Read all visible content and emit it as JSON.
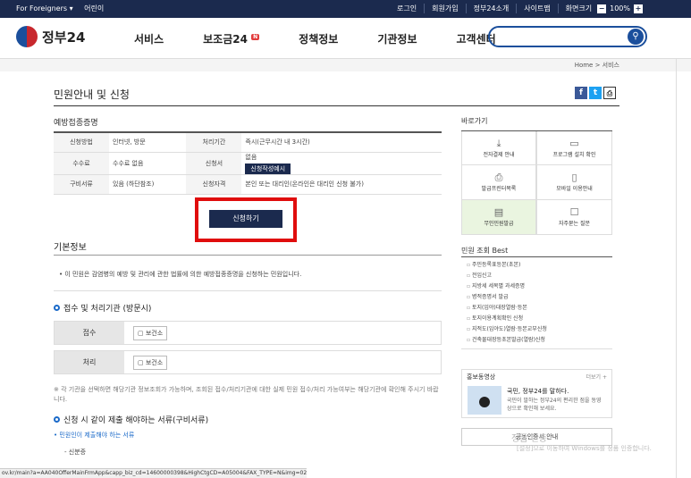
{
  "topbar": {
    "foreigners": "For Foreigners ▾",
    "kids": "어린이",
    "links": [
      "로그인",
      "회원가입",
      "정부24소개",
      "사이트맵",
      "화면크기"
    ],
    "zoom_minus": "−",
    "zoom_value": "100%",
    "zoom_plus": "+"
  },
  "gnb": {
    "logo": "정부24",
    "menu": [
      "서비스",
      "보조금24",
      "정책정보",
      "기관정보",
      "고객센터"
    ],
    "badge": "N",
    "search_icon": "search-icon"
  },
  "breadcrumb": "Home > 서비스",
  "page_title": "민원안내 및 신청",
  "service_name": "예방접종증명",
  "info_rows": [
    {
      "k1": "신청방법",
      "v1": "인터넷, 방문",
      "k2": "처리기간",
      "v2": "즉시(근무시간 내 3시간)"
    },
    {
      "k1": "수수료",
      "v1": "수수료 없음",
      "k2": "신청서",
      "v2": "없음",
      "btn": "신청작성예시"
    },
    {
      "k1": "구비서류",
      "v1": "있음 (하단참조)",
      "k2": "신청자격",
      "v2": "본인 또는 대리인(온라인은 대리인 신청 불가)"
    }
  ],
  "apply_button": "신청하기",
  "basic_info": {
    "title": "기본정보",
    "notice": "• 이 민원은 감염병의 예방 및 관리에 관한 법률에 의한 예방접종증명을 신청하는 민원입니다."
  },
  "processing": {
    "title": "접수 및 처리기관 (방문시)",
    "rows": [
      {
        "label": "접수",
        "tag": "보건소"
      },
      {
        "label": "처리",
        "tag": "보건소"
      }
    ],
    "note": "※ 각 기관을 선택하면 해당기관 정보조회가 가능하며, 조회된 접수/처리기관에 대한 실제 민원 접수/처리 가능여부는 해당기관에 확인해 주시기 바랍니다."
  },
  "documents": {
    "title": "신청 시 같이 제출 해야하는 서류(구비서류)",
    "link": "• 민원인이 제출해야 하는 서류",
    "item": "- 신분증"
  },
  "sidebar": {
    "quick_title": "바로가기",
    "quick": [
      {
        "label": "전자결제 안내",
        "icon": "download-icon"
      },
      {
        "label": "프로그램 설치 확인",
        "icon": "monitor-icon"
      },
      {
        "label": "발급프린터목록",
        "icon": "printer-icon"
      },
      {
        "label": "모바일 이용안내",
        "icon": "mobile-icon"
      },
      {
        "label": "무인민원발급",
        "icon": "kiosk-icon"
      },
      {
        "label": "자주묻는 질문",
        "icon": "faq-icon"
      }
    ],
    "best_title": "민원 조회 Best",
    "best": [
      "주민등록표등본(초본)",
      "전입신고",
      "지방세 세목별 과세증명",
      "병적증명서 발급",
      "토지(임야)대장열람·등본",
      "토지이용계획확인 신청",
      "지적도(임야도)열람·등본교부신청",
      "건축물대장등초본발급(열람)신청"
    ],
    "promo_title": "홍보동영상",
    "promo_more": "더보기 +",
    "promo_t1": "국민, 정부24를 말하다.",
    "promo_t2": "국민이 말하는 정부24의 편리한 점을 동영상으로 확인해 보세요.",
    "cert": "공동인증서 안내"
  },
  "watermark": "정품 인증",
  "watermark2": "[설정]으로 이동하여 Windows를 정품 인증합니다.",
  "status_url": "ov.kr/main?a=AA040OfferMainFrmApp&capp_biz_cd=14600000398&HighCtgCD=A05004&FAX_TYPE=N&img=02&"
}
